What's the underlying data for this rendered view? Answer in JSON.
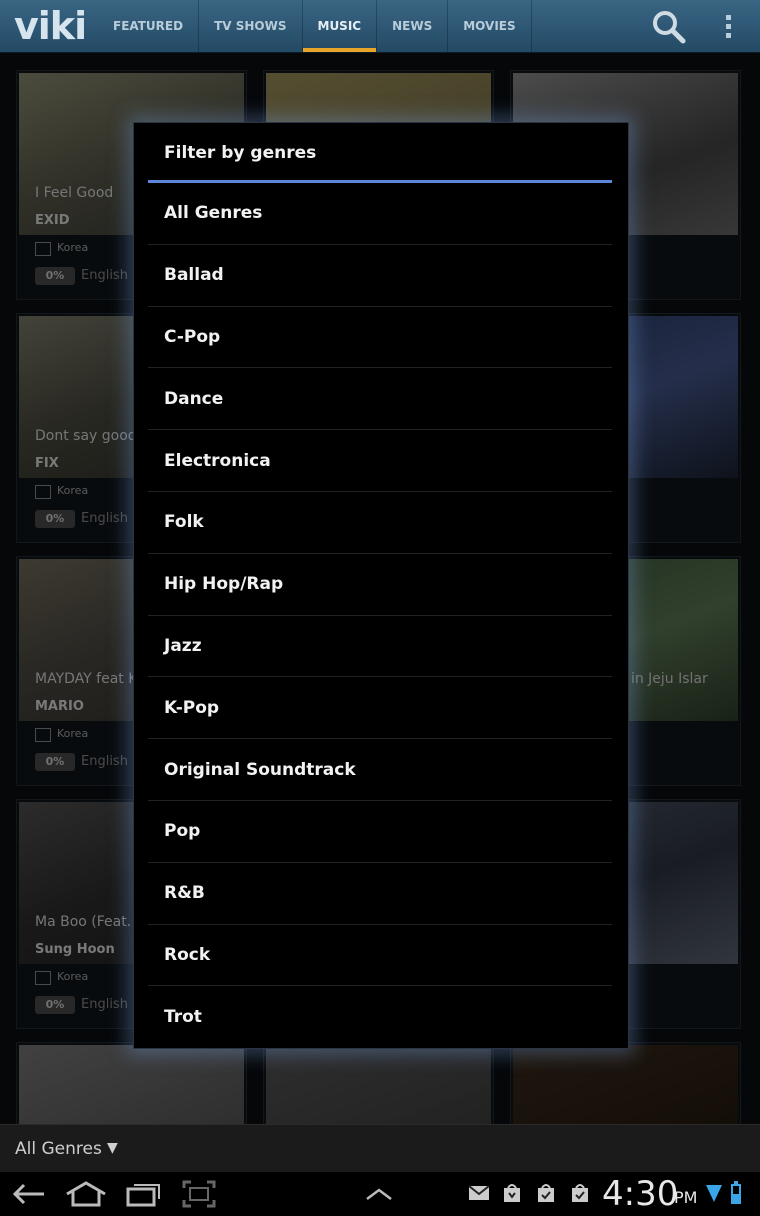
{
  "app": {
    "logo": "viki"
  },
  "nav": {
    "tabs": [
      {
        "label": "FEATURED"
      },
      {
        "label": "TV SHOWS"
      },
      {
        "label": "MUSIC",
        "active": true
      },
      {
        "label": "NEWS"
      },
      {
        "label": "MOVIES"
      }
    ],
    "active_color": "#e9a42a"
  },
  "cards": [
    {
      "title": "I Feel Good",
      "artist": "EXID",
      "country": "Korea",
      "progress": "0%",
      "language": "English"
    },
    {
      "title": "Dont say good",
      "artist": "FIX",
      "country": "Korea",
      "progress": "0%",
      "language": "English"
    },
    {
      "title": "MAYDAY feat K",
      "artist": "MARIO",
      "country": "Korea",
      "progress": "0%",
      "language": "English"
    },
    {
      "title": "Ma Boo (Feat.",
      "artist": "Sung Hoon",
      "country": "Korea",
      "progress": "0%",
      "language": "English"
    }
  ],
  "right_card_title": "t in Jeju Islar",
  "dialog": {
    "title": "Filter by genres",
    "accent": "#5f86d6",
    "options": [
      "All Genres",
      "Ballad",
      "C-Pop",
      "Dance",
      "Electronica",
      "Folk",
      "Hip Hop/Rap",
      "Jazz",
      "K-Pop",
      "Original Soundtrack",
      "Pop",
      "R&B",
      "Rock",
      "Trot"
    ]
  },
  "filter_bar": {
    "selected": "All Genres",
    "caret": "▼"
  },
  "system": {
    "time": "4:30",
    "ampm": "PM"
  }
}
